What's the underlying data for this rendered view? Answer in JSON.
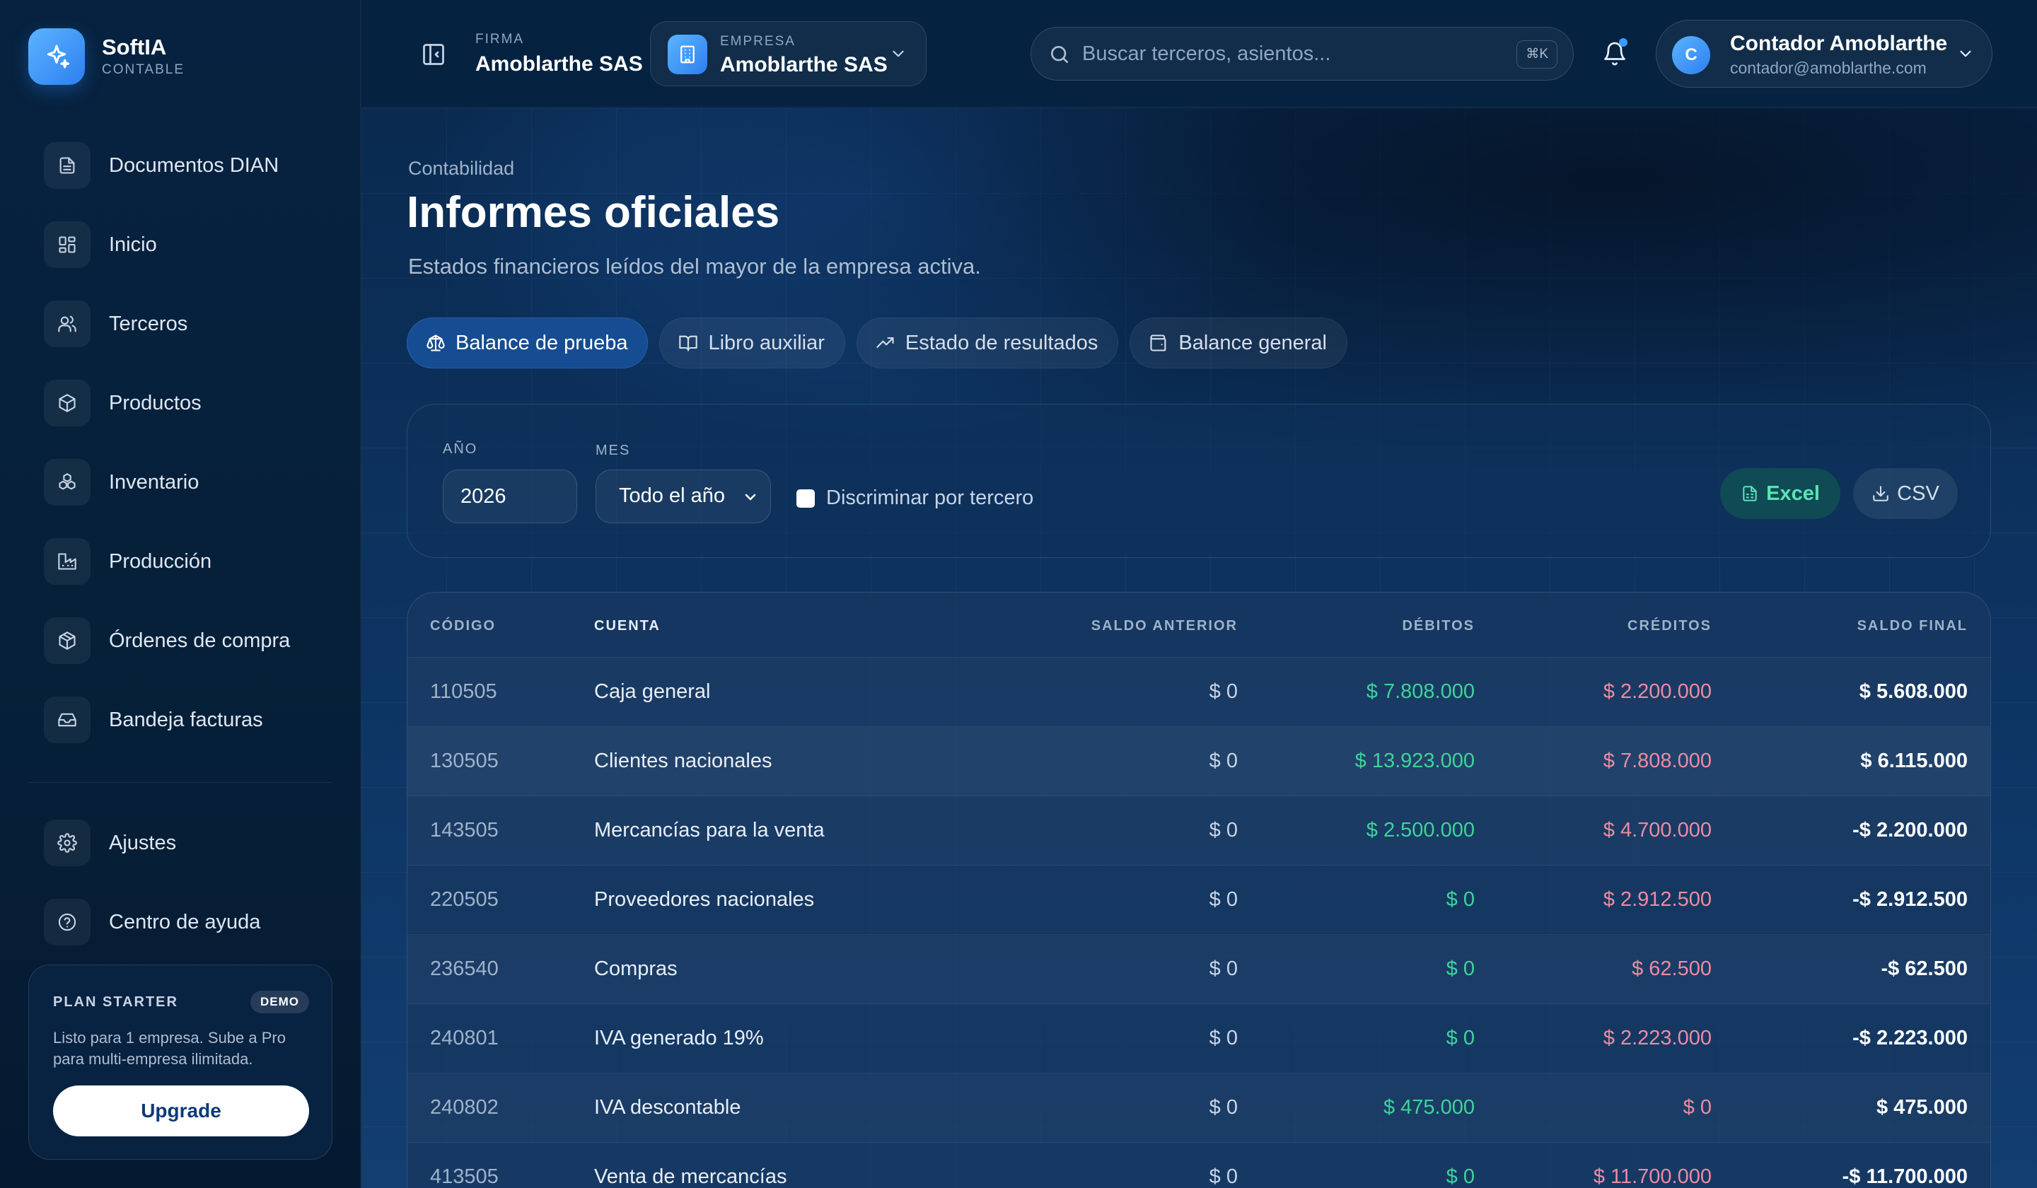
{
  "brand": {
    "name": "SoftIA",
    "sub": "CONTABLE"
  },
  "sidebar": {
    "items": [
      {
        "label": "Documentos DIAN",
        "icon": "document-icon"
      },
      {
        "label": "Inicio",
        "icon": "grid-icon"
      },
      {
        "label": "Terceros",
        "icon": "users-icon"
      },
      {
        "label": "Productos",
        "icon": "box-icon"
      },
      {
        "label": "Inventario",
        "icon": "boxes-icon"
      },
      {
        "label": "Producción",
        "icon": "factory-icon"
      },
      {
        "label": "Órdenes de compra",
        "icon": "package-icon"
      },
      {
        "label": "Bandeja facturas",
        "icon": "inbox-icon"
      }
    ],
    "bottom": [
      {
        "label": "Ajustes",
        "icon": "gear-icon"
      },
      {
        "label": "Centro de ayuda",
        "icon": "help-icon"
      }
    ],
    "plan": {
      "title": "PLAN STARTER",
      "badge": "DEMO",
      "desc": "Listo para 1 empresa. Sube a Pro para multi-empresa ilimitada.",
      "button": "Upgrade"
    }
  },
  "topbar": {
    "firma_label": "FIRMA",
    "firma_name": "Amoblarthe SAS",
    "empresa_label": "EMPRESA",
    "empresa_name": "Amoblarthe SAS",
    "search_placeholder": "Buscar terceros, asientos...",
    "search_shortcut": "⌘K",
    "user_initial": "C",
    "user_name": "Contador Amoblarthe",
    "user_email": "contador@amoblarthe.com"
  },
  "page": {
    "breadcrumb": "Contabilidad",
    "title": "Informes oficiales",
    "subtitle": "Estados financieros leídos del mayor de la empresa activa."
  },
  "tabs": [
    {
      "label": "Balance de prueba",
      "active": true
    },
    {
      "label": "Libro auxiliar",
      "active": false
    },
    {
      "label": "Estado de resultados",
      "active": false
    },
    {
      "label": "Balance general",
      "active": false
    }
  ],
  "filters": {
    "year_label": "AÑO",
    "year_value": "2026",
    "month_label": "MES",
    "month_value": "Todo el año",
    "checkbox_label": "Discriminar por tercero",
    "excel_label": "Excel",
    "csv_label": "CSV"
  },
  "table": {
    "headers": {
      "code": "CÓDIGO",
      "account": "CUENTA",
      "prev": "SALDO ANTERIOR",
      "debits": "DÉBITOS",
      "credits": "CRÉDITOS",
      "final": "SALDO FINAL"
    },
    "rows": [
      {
        "code": "110505",
        "account": "Caja general",
        "prev": "$ 0",
        "debits": "$ 7.808.000",
        "credits": "$ 2.200.000",
        "final": "$ 5.608.000"
      },
      {
        "code": "130505",
        "account": "Clientes nacionales",
        "prev": "$ 0",
        "debits": "$ 13.923.000",
        "credits": "$ 7.808.000",
        "final": "$ 6.115.000"
      },
      {
        "code": "143505",
        "account": "Mercancías para la venta",
        "prev": "$ 0",
        "debits": "$ 2.500.000",
        "credits": "$ 4.700.000",
        "final": "-$ 2.200.000"
      },
      {
        "code": "220505",
        "account": "Proveedores nacionales",
        "prev": "$ 0",
        "debits": "$ 0",
        "credits": "$ 2.912.500",
        "final": "-$ 2.912.500"
      },
      {
        "code": "236540",
        "account": "Compras",
        "prev": "$ 0",
        "debits": "$ 0",
        "credits": "$ 62.500",
        "final": "-$ 62.500"
      },
      {
        "code": "240801",
        "account": "IVA generado 19%",
        "prev": "$ 0",
        "debits": "$ 0",
        "credits": "$ 2.223.000",
        "final": "-$ 2.223.000"
      },
      {
        "code": "240802",
        "account": "IVA descontable",
        "prev": "$ 0",
        "debits": "$ 475.000",
        "credits": "$ 0",
        "final": "$ 475.000"
      },
      {
        "code": "413505",
        "account": "Venta de mercancías",
        "prev": "$ 0",
        "debits": "$ 0",
        "credits": "$ 11.700.000",
        "final": "-$ 11.700.000"
      }
    ]
  },
  "colors": {
    "accent": "#2d7ff0",
    "debit": "#3ed39a",
    "credit": "#ee8aa2",
    "excel": "#5be3b2"
  }
}
